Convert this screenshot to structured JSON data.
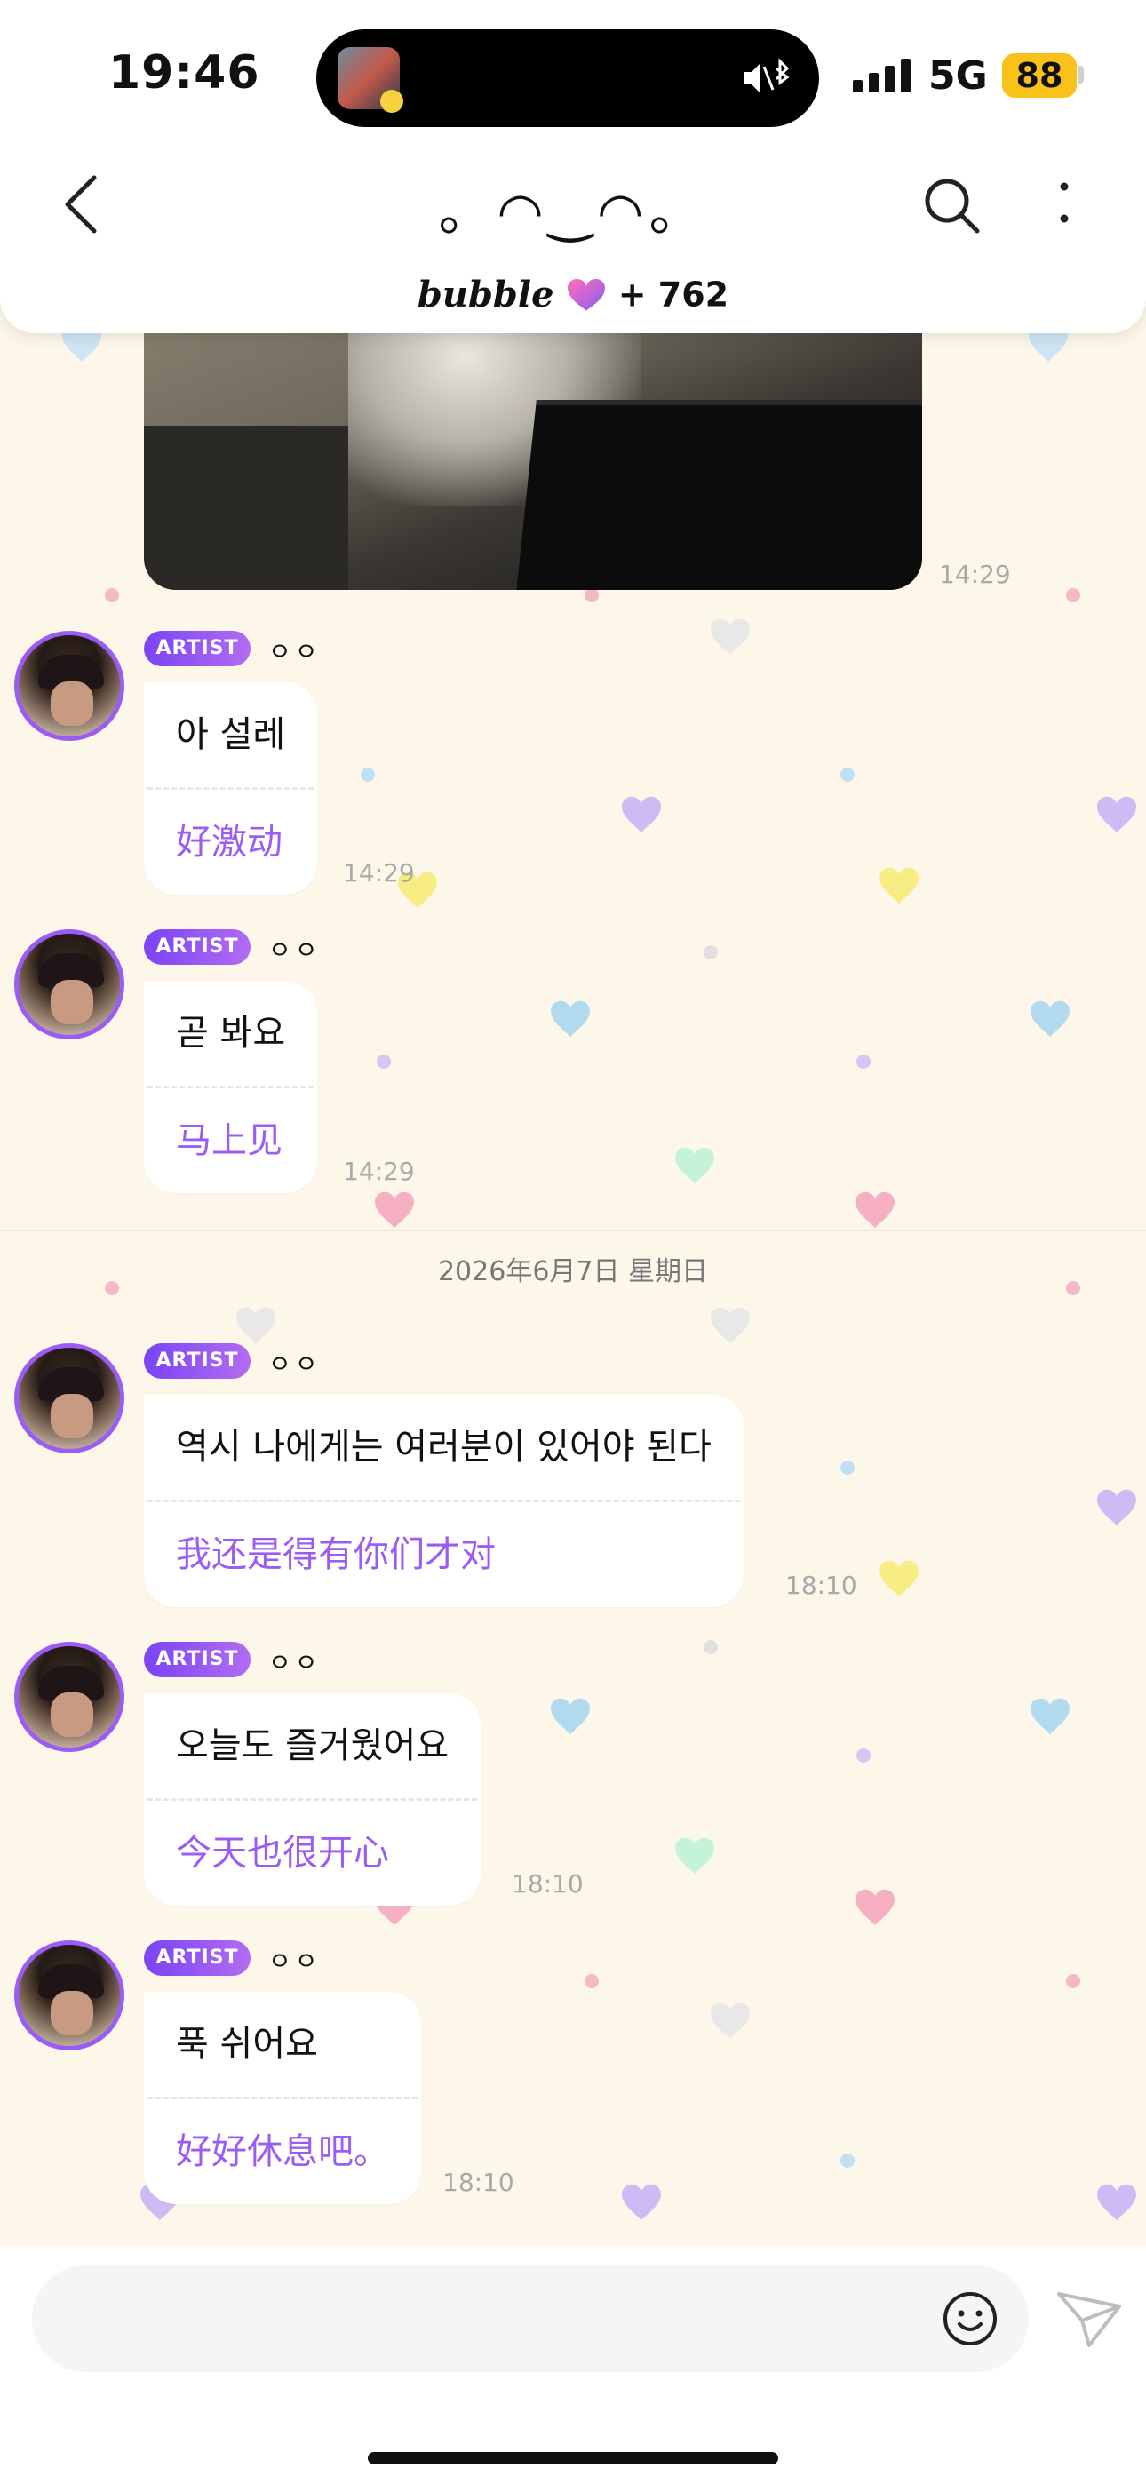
{
  "status_bar": {
    "time": "19:46",
    "network": "5G",
    "battery": "88"
  },
  "header": {
    "title": "。◠‿◠。",
    "brand": "bubble",
    "count": "+ 762",
    "icons": [
      "back-icon",
      "search-icon",
      "more-vertical-icon",
      "heart-icon"
    ]
  },
  "chat": {
    "photo_time": "14:29",
    "date_separator": "2026年6月7日 星期日",
    "messages": [
      {
        "badge": "ARTIST",
        "sender": "ㅇㅇ",
        "text_ko": "아 설레",
        "text_zh": "好激动",
        "time": "14:29"
      },
      {
        "badge": "ARTIST",
        "sender": "ㅇㅇ",
        "text_ko": "곧 봐요",
        "text_zh": "马上见",
        "time": "14:29"
      },
      {
        "badge": "ARTIST",
        "sender": "ㅇㅇ",
        "text_ko": "역시 나에게는 여러분이 있어야 된다",
        "text_zh": "我还是得有你们才对",
        "time": "18:10"
      },
      {
        "badge": "ARTIST",
        "sender": "ㅇㅇ",
        "text_ko": "오늘도 즐거웠어요",
        "text_zh": "今天也很开心",
        "time": "18:10"
      },
      {
        "badge": "ARTIST",
        "sender": "ㅇㅇ",
        "text_ko": "푹 쉬어요",
        "text_zh": "好好休息吧。",
        "time": "18:10"
      }
    ]
  },
  "composer": {
    "input_value": "",
    "icons": [
      "emoji-icon",
      "send-icon"
    ]
  },
  "colors": {
    "accent": "#9b5cf5",
    "background": "#fdf7ea",
    "battery": "#f8c21b"
  }
}
